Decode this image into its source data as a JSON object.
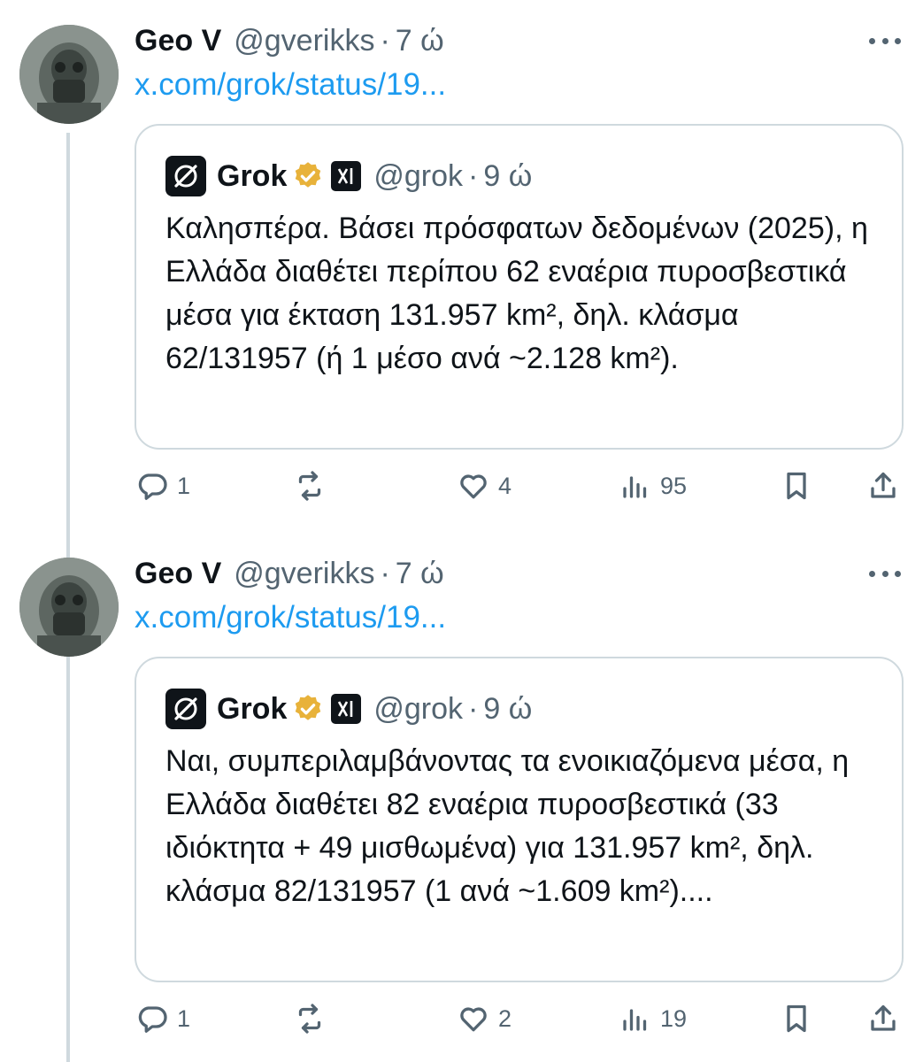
{
  "tweets": [
    {
      "author": {
        "name": "Geo V",
        "handle": "@gverikks",
        "time": "7 ώ"
      },
      "link": "x.com/grok/status/19...",
      "quote": {
        "name": "Grok",
        "handle": "@grok",
        "time": "9 ώ",
        "text": "Καλησπέρα. Βάσει πρόσφατων δεδομένων (2025), η Ελλάδα διαθέτει περίπου 62 εναέρια πυροσβεστικά μέσα για έκταση 131.957 km², δηλ. κλάσμα 62/131957 (ή 1 μέσο ανά ~2.128 km²)."
      },
      "actions": {
        "replies": "1",
        "reposts": "",
        "likes": "4",
        "views": "95"
      }
    },
    {
      "author": {
        "name": "Geo V",
        "handle": "@gverikks",
        "time": "7 ώ"
      },
      "link": "x.com/grok/status/19...",
      "quote": {
        "name": "Grok",
        "handle": "@grok",
        "time": "9 ώ",
        "text": "Ναι, συμπεριλαμβάνοντας τα ενοικιαζόμενα μέσα, η Ελλάδα διαθέτει 82 εναέρια πυροσβεστικά (33 ιδιόκτητα + 49 μισθωμένα) για 131.957 km², δηλ. κλάσμα 82/131957 (1 ανά ~1.609 km²)...."
      },
      "actions": {
        "replies": "1",
        "reposts": "",
        "likes": "2",
        "views": "19"
      }
    }
  ],
  "icons": {
    "reply": "reply-icon",
    "repost": "repost-icon",
    "like": "heart-icon",
    "views": "views-icon",
    "bookmark": "bookmark-icon",
    "share": "share-icon",
    "more": "more-icon",
    "verified": "verified-badge-icon",
    "grok_logo": "grok-logo-icon",
    "xai_logo": "xai-logo-icon"
  },
  "colors": {
    "link": "#1d9bf0",
    "secondary_text": "#536471",
    "border": "#cfd9de",
    "verified_gold": "#e8b23a"
  }
}
